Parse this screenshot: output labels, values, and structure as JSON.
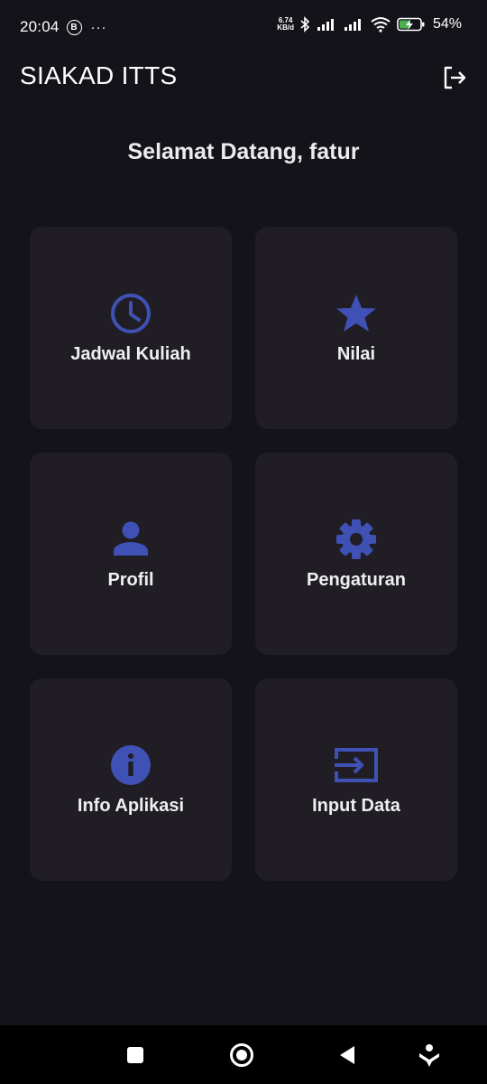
{
  "status_bar": {
    "time": "20:04",
    "badge_letter": "B",
    "more_dots": "···",
    "net_speed_value": "6.74",
    "net_speed_unit": "KB/d",
    "battery_percent": "54%"
  },
  "app_bar": {
    "title": "SIAKAD ITTS",
    "logout_icon": "logout-icon"
  },
  "greeting": "Selamat Datang, fatur",
  "menu": [
    {
      "label": "Jadwal Kuliah",
      "icon": "clock-icon"
    },
    {
      "label": "Nilai",
      "icon": "star-icon"
    },
    {
      "label": "Profil",
      "icon": "person-icon"
    },
    {
      "label": "Pengaturan",
      "icon": "gear-icon"
    },
    {
      "label": "Info Aplikasi",
      "icon": "info-icon"
    },
    {
      "label": "Input Data",
      "icon": "input-icon"
    }
  ],
  "colors": {
    "background": "#15131a",
    "card": "#201e24",
    "accent": "#3f51b5",
    "text": "#ffffff"
  }
}
